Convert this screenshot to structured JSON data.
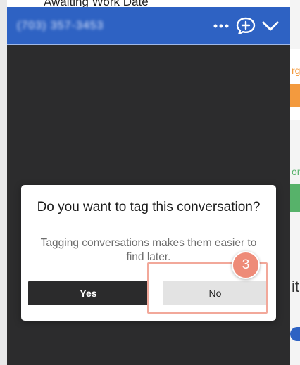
{
  "background": {
    "top_text": "Awaiting Work Date",
    "right_fragments": [
      "rg",
      "on",
      "it"
    ]
  },
  "chat_widget": {
    "header": {
      "phone": "(703) 357-3453",
      "more_icon": "ellipsis-icon",
      "new_chat_icon": "chat-plus-icon",
      "collapse_icon": "chevron-down-icon",
      "color": "#2e62c3"
    },
    "dialog": {
      "title": "Do you want to tag this conversation?",
      "subtitle": "Tagging conversations makes them easier to find later.",
      "yes_label": "Yes",
      "no_label": "No"
    }
  },
  "annotation": {
    "step_number": "3",
    "color": "#ee8b78"
  }
}
